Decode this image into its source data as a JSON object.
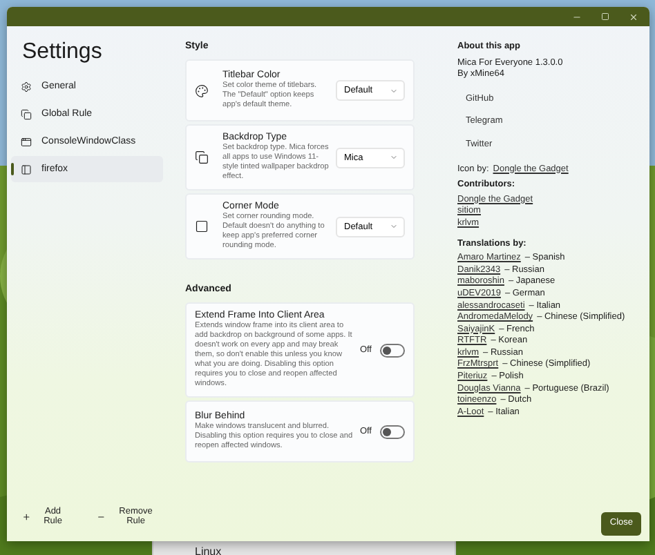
{
  "title": "Settings",
  "nav": [
    {
      "label": "General",
      "selected": false
    },
    {
      "label": "Global Rule",
      "selected": false
    },
    {
      "label": "ConsoleWindowClass",
      "selected": false
    },
    {
      "label": "firefox",
      "selected": true
    }
  ],
  "footer_actions": [
    "Add Rule",
    "Remove Rule"
  ],
  "sections": [
    {
      "heading": "Style",
      "settings": [
        {
          "kind": "dropdown",
          "title": "Titlebar Color",
          "description": "Set color theme of titlebars. The \"Default\" option keeps app's default theme.",
          "value": "Default"
        },
        {
          "kind": "dropdown",
          "title": "Backdrop Type",
          "description": "Set backdrop type. Mica forces all apps to use Windows 11-style tinted wallpaper backdrop effect.",
          "value": "Mica"
        },
        {
          "kind": "dropdown",
          "title": "Corner Mode",
          "description": "Set corner rounding mode. Default doesn't do anything to keep app's preferred corner rounding mode.",
          "value": "Default"
        }
      ]
    },
    {
      "heading": "Advanced",
      "settings": [
        {
          "kind": "toggle",
          "title": "Extend Frame Into Client Area",
          "description": "Extends window frame into its client area to add backdrop on background of some apps. It doesn't work on every app and may break them, so don't enable this unless you know what you are doing. Disabling this option requires you to close and reopen affected windows.",
          "state_label": "Off",
          "on": false
        },
        {
          "kind": "toggle",
          "title": "Blur Behind",
          "description": "Make windows translucent and blurred. Disabling this option requires you to close and reopen affected windows.",
          "state_label": "Off",
          "on": false
        }
      ]
    }
  ],
  "about": {
    "heading": "About this app",
    "app": "Mica For Everyone 1.3.0.0",
    "author": "By xMine64",
    "links": [
      "GitHub",
      "Telegram",
      "Twitter"
    ],
    "icon_by_label": "Icon by:",
    "icon_by": "Dongle the Gadget",
    "contributors_heading": "Contributors:",
    "contributors": [
      "Dongle the Gadget",
      "sitiom",
      "krlvm"
    ],
    "translations_heading": "Translations by:",
    "translations": [
      {
        "name": "Amaro Martinez",
        "language": "– Spanish"
      },
      {
        "name": "Danik2343",
        "language": "– Russian"
      },
      {
        "name": "maboroshin",
        "language": "– Japanese"
      },
      {
        "name": "uDEV2019",
        "language": "– German"
      },
      {
        "name": "alessandrocaseti",
        "language": "– Italian"
      },
      {
        "name": "AndromedaMelody",
        "language": "– Chinese (Simplified)"
      },
      {
        "name": "SaiyajinK",
        "language": "– French"
      },
      {
        "name": "RTFTR",
        "language": "– Korean"
      },
      {
        "name": "krlvm",
        "language": "– Russian"
      },
      {
        "name": "FrzMtrsprt",
        "language": "– Chinese (Simplified)"
      },
      {
        "name": "Piteriuz",
        "language": "– Polish"
      },
      {
        "name": "Douglas Vianna",
        "language": "– Portuguese (Brazil)"
      },
      {
        "name": "toineenzo",
        "language": "– Dutch"
      },
      {
        "name": "A-Loot",
        "language": "– Italian"
      }
    ]
  },
  "close_button": "Close",
  "background_window": {
    "item": "Linux"
  }
}
